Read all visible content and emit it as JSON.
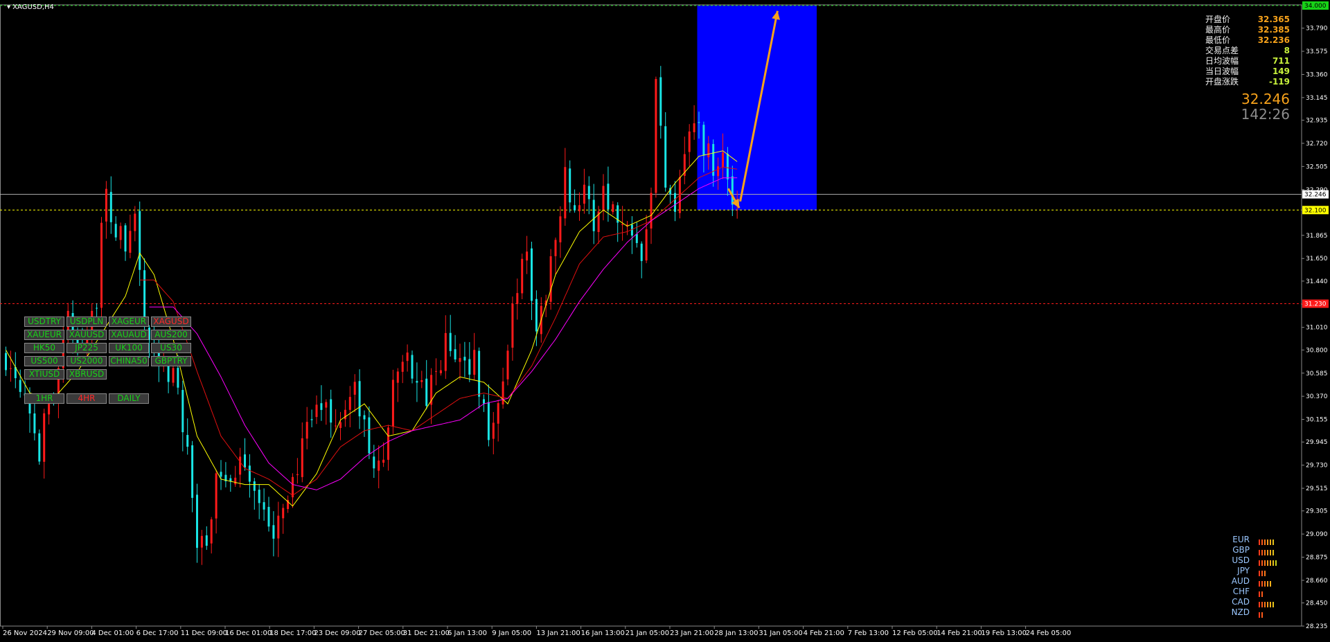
{
  "window": {
    "title": "XAGUSD,H4"
  },
  "price_axis": {
    "min": 28.235,
    "max": 34.0,
    "ticks": [
      "33.790",
      "33.575",
      "33.360",
      "33.145",
      "32.935",
      "32.720",
      "32.505",
      "32.290",
      "31.865",
      "31.650",
      "31.440",
      "31.225",
      "31.010",
      "30.800",
      "30.585",
      "30.370",
      "30.155",
      "29.945",
      "29.730",
      "29.515",
      "29.305",
      "29.090",
      "28.875",
      "28.660",
      "28.450",
      "28.235"
    ],
    "labels": [
      {
        "name": "top-level",
        "text": "34.000",
        "value": 34.0,
        "color": "#17d317",
        "textColor": "#000000"
      },
      {
        "name": "current-price",
        "text": "32.246",
        "value": 32.246,
        "color": "#ffffff",
        "textColor": "#000000"
      },
      {
        "name": "yellow-level",
        "text": "32.100",
        "value": 32.1,
        "color": "#ffff00",
        "textColor": "#000000"
      },
      {
        "name": "red-level",
        "text": "31.230",
        "value": 31.23,
        "color": "#ff1a1a",
        "textColor": "#ffffff"
      }
    ]
  },
  "time_axis": {
    "labels": [
      "26 Nov 2024",
      "29 Nov 09:00",
      "4 Dec 01:00",
      "6 Dec 17:00",
      "11 Dec 09:00",
      "16 Dec 01:00",
      "18 Dec 17:00",
      "23 Dec 09:00",
      "27 Dec 05:00",
      "31 Dec 21:00",
      "6 Jan 13:00",
      "9 Jan 05:00",
      "13 Jan 21:00",
      "16 Jan 13:00",
      "21 Jan 05:00",
      "23 Jan 21:00",
      "28 Jan 13:00",
      "31 Jan 05:00",
      "4 Feb 21:00",
      "7 Feb 13:00",
      "12 Feb 05:00",
      "14 Feb 21:00",
      "19 Feb 13:00",
      "24 Feb 05:00"
    ]
  },
  "stats": [
    {
      "label": "开盘价",
      "value": "32.365",
      "color": "#f7a21b"
    },
    {
      "label": "最高价",
      "value": "32.385",
      "color": "#f7a21b"
    },
    {
      "label": "最低价",
      "value": "32.236",
      "color": "#f7a21b"
    },
    {
      "label": "交易点差",
      "value": "8",
      "color": "#c8f23c"
    },
    {
      "label": "日均波幅",
      "value": "711",
      "color": "#c8f23c"
    },
    {
      "label": "当日波幅",
      "value": "149",
      "color": "#c8f23c"
    },
    {
      "label": "开盘涨跌",
      "value": "-119",
      "color": "#c8f23c"
    }
  ],
  "big_price": "32.246",
  "timer": "142:26",
  "symbols": [
    [
      "USDTRY",
      "USDPLN",
      "XAGEUR",
      "XAGUSD"
    ],
    [
      "XAUEUR",
      "XAUUSD",
      "XAUAUD",
      "AUS200"
    ],
    [
      "HK50",
      "JP225",
      "UK100",
      "US30"
    ],
    [
      "US500",
      "US2000",
      "CHINA50",
      "GBPTRY"
    ],
    [
      "XTIUSD",
      "XBRUSD"
    ]
  ],
  "active_symbol": "XAGUSD",
  "timeframes": [
    "1HR",
    "4HR",
    "DAILY"
  ],
  "active_timeframe": "4HR",
  "currency_strength": [
    {
      "currency": "EUR",
      "bars": 6
    },
    {
      "currency": "GBP",
      "bars": 6
    },
    {
      "currency": "USD",
      "bars": 8
    },
    {
      "currency": "JPY",
      "bars": 3
    },
    {
      "currency": "AUD",
      "bars": 5
    },
    {
      "currency": "CHF",
      "bars": 2
    },
    {
      "currency": "CAD",
      "bars": 6
    },
    {
      "currency": "NZD",
      "bars": 2
    }
  ],
  "colors": {
    "bull": "#ff1a1a",
    "bear": "#19e5e5",
    "grid": "#3c3c3c",
    "ma_fast": "#ffff00",
    "ma_mid": "#e01010",
    "ma_slow": "#ff00ff",
    "projection_box": "#0000ff",
    "arrow": "#f7a21b"
  },
  "chart_data": {
    "type": "candlestick",
    "symbol": "XAGUSD",
    "timeframe": "H4",
    "close_path": [
      [
        0,
        30.75
      ],
      [
        3,
        30.55
      ],
      [
        5,
        30.3
      ],
      [
        7,
        29.85
      ],
      [
        8,
        30.1
      ],
      [
        10,
        30.4
      ],
      [
        11,
        30.75
      ],
      [
        13,
        31.05
      ],
      [
        15,
        30.85
      ],
      [
        17,
        31.05
      ],
      [
        19,
        31.3
      ],
      [
        20,
        31.9
      ],
      [
        21,
        32.2
      ],
      [
        23,
        31.9
      ],
      [
        25,
        31.75
      ],
      [
        27,
        32.05
      ],
      [
        28,
        31.55
      ],
      [
        29,
        31.0
      ],
      [
        31,
        30.7
      ],
      [
        32,
        30.55
      ],
      [
        34,
        30.6
      ],
      [
        36,
        30.4
      ],
      [
        38,
        29.9
      ],
      [
        40,
        29.0
      ],
      [
        42,
        28.9
      ],
      [
        44,
        29.7
      ],
      [
        46,
        29.65
      ],
      [
        48,
        29.55
      ],
      [
        50,
        29.8
      ],
      [
        52,
        29.55
      ],
      [
        54,
        29.3
      ],
      [
        56,
        28.95
      ],
      [
        58,
        29.4
      ],
      [
        60,
        29.6
      ],
      [
        62,
        29.85
      ],
      [
        64,
        30.15
      ],
      [
        66,
        30.25
      ],
      [
        67,
        30.35
      ],
      [
        69,
        30.05
      ],
      [
        71,
        30.3
      ],
      [
        73,
        30.4
      ],
      [
        75,
        30.05
      ],
      [
        77,
        29.65
      ],
      [
        79,
        29.85
      ],
      [
        81,
        30.4
      ],
      [
        83,
        30.7
      ],
      [
        84,
        30.8
      ],
      [
        86,
        30.45
      ],
      [
        88,
        30.35
      ],
      [
        90,
        30.55
      ],
      [
        92,
        30.85
      ],
      [
        94,
        30.75
      ],
      [
        96,
        30.6
      ],
      [
        98,
        30.8
      ],
      [
        99,
        30.4
      ],
      [
        101,
        30.05
      ],
      [
        103,
        30.3
      ],
      [
        105,
        30.75
      ],
      [
        107,
        31.45
      ],
      [
        109,
        31.65
      ],
      [
        110,
        31.3
      ],
      [
        111,
        30.95
      ],
      [
        113,
        31.35
      ],
      [
        115,
        31.95
      ],
      [
        117,
        32.4
      ],
      [
        119,
        32.15
      ],
      [
        121,
        32.25
      ],
      [
        123,
        31.95
      ],
      [
        125,
        32.35
      ],
      [
        127,
        32.1
      ],
      [
        129,
        31.95
      ],
      [
        131,
        32.0
      ],
      [
        133,
        31.75
      ],
      [
        135,
        32.35
      ],
      [
        136,
        33.25
      ],
      [
        138,
        32.4
      ],
      [
        140,
        32.2
      ],
      [
        142,
        32.7
      ],
      [
        144,
        32.95
      ],
      [
        146,
        32.7
      ],
      [
        148,
        32.55
      ],
      [
        150,
        32.6
      ],
      [
        152,
        32.15
      ],
      [
        153,
        32.25
      ]
    ],
    "moving_averages": [
      {
        "color": "ma_fast",
        "points": [
          [
            0,
            30.8
          ],
          [
            5,
            30.4
          ],
          [
            10,
            30.35
          ],
          [
            15,
            30.6
          ],
          [
            20,
            30.95
          ],
          [
            25,
            31.3
          ],
          [
            28,
            31.7
          ],
          [
            31,
            31.5
          ],
          [
            35,
            30.9
          ],
          [
            40,
            30.0
          ],
          [
            45,
            29.6
          ],
          [
            50,
            29.55
          ],
          [
            55,
            29.55
          ],
          [
            60,
            29.35
          ],
          [
            65,
            29.65
          ],
          [
            70,
            30.15
          ],
          [
            75,
            30.3
          ],
          [
            80,
            30.0
          ],
          [
            85,
            30.05
          ],
          [
            90,
            30.4
          ],
          [
            95,
            30.55
          ],
          [
            100,
            30.5
          ],
          [
            105,
            30.3
          ],
          [
            110,
            30.8
          ],
          [
            115,
            31.5
          ],
          [
            120,
            31.9
          ],
          [
            125,
            32.1
          ],
          [
            130,
            31.95
          ],
          [
            135,
            32.05
          ],
          [
            140,
            32.35
          ],
          [
            145,
            32.6
          ],
          [
            150,
            32.65
          ],
          [
            153,
            32.55
          ]
        ]
      },
      {
        "color": "ma_mid",
        "points": [
          [
            28,
            31.45
          ],
          [
            31,
            31.45
          ],
          [
            35,
            31.25
          ],
          [
            40,
            30.6
          ],
          [
            45,
            30.0
          ],
          [
            50,
            29.7
          ],
          [
            55,
            29.6
          ],
          [
            60,
            29.45
          ],
          [
            65,
            29.6
          ],
          [
            70,
            29.9
          ],
          [
            75,
            30.05
          ],
          [
            80,
            30.1
          ],
          [
            85,
            30.05
          ],
          [
            90,
            30.2
          ],
          [
            95,
            30.35
          ],
          [
            100,
            30.4
          ],
          [
            105,
            30.35
          ],
          [
            110,
            30.65
          ],
          [
            115,
            31.1
          ],
          [
            120,
            31.6
          ],
          [
            125,
            31.85
          ],
          [
            130,
            31.9
          ],
          [
            135,
            32.0
          ],
          [
            140,
            32.2
          ],
          [
            145,
            32.4
          ],
          [
            150,
            32.5
          ],
          [
            153,
            32.48
          ]
        ]
      },
      {
        "color": "ma_slow",
        "points": [
          [
            30,
            31.2
          ],
          [
            35,
            31.2
          ],
          [
            40,
            30.95
          ],
          [
            45,
            30.55
          ],
          [
            50,
            30.1
          ],
          [
            55,
            29.75
          ],
          [
            60,
            29.55
          ],
          [
            65,
            29.5
          ],
          [
            70,
            29.6
          ],
          [
            75,
            29.8
          ],
          [
            80,
            29.95
          ],
          [
            85,
            30.05
          ],
          [
            90,
            30.1
          ],
          [
            95,
            30.15
          ],
          [
            100,
            30.3
          ],
          [
            105,
            30.35
          ],
          [
            110,
            30.6
          ],
          [
            115,
            30.9
          ],
          [
            120,
            31.25
          ],
          [
            125,
            31.55
          ],
          [
            130,
            31.8
          ],
          [
            135,
            32.0
          ],
          [
            140,
            32.15
          ],
          [
            145,
            32.3
          ],
          [
            150,
            32.4
          ],
          [
            153,
            32.4
          ]
        ]
      }
    ],
    "horizontal_lines": [
      {
        "value": 34.0,
        "color": "#17d317",
        "style": "dashed"
      },
      {
        "value": 32.246,
        "color": "#b0b0b0",
        "style": "solid"
      },
      {
        "value": 32.1,
        "color": "#ffff00",
        "style": "dashed"
      },
      {
        "value": 31.23,
        "color": "#ff1a1a",
        "style": "dashed"
      }
    ],
    "projection": {
      "box": {
        "from_bar": 145,
        "to_bar": 170,
        "low": 32.1,
        "high": 34.0
      },
      "arrows": [
        {
          "from": [
            151.5,
            32.3
          ],
          "to": [
            153.8,
            32.12
          ]
        },
        {
          "from": [
            154,
            32.18
          ],
          "to": [
            161.8,
            33.95
          ]
        }
      ]
    }
  }
}
